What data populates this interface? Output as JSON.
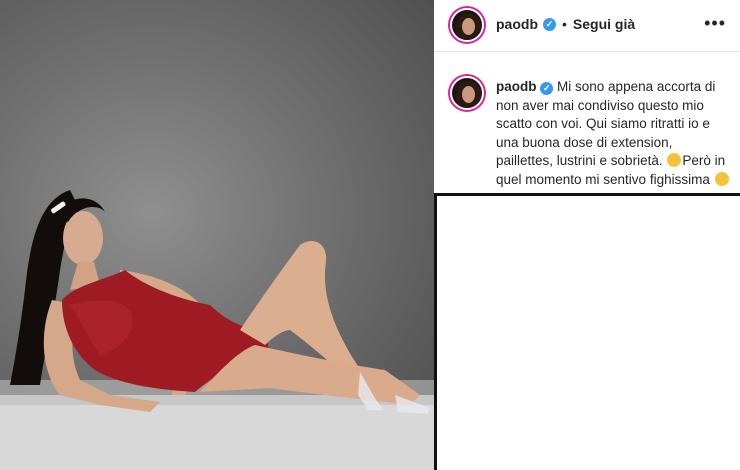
{
  "post": {
    "header": {
      "username": "paodb",
      "separator": "•",
      "follow_label": "Segui già",
      "more_label": "•••"
    },
    "caption": {
      "username": "paodb",
      "text_1": "Mi sono appena accorta di non aver mai condiviso questo mio scatto con voi. Qui siamo ritratti io e una buona dose di extension, paillettes, lustrini e sobrietà.",
      "text_2": "Però in quel momento mi sentivo fighissima",
      "heart": "❤"
    },
    "icons": {
      "verified": "verified-badge-icon",
      "more": "more-options-icon"
    },
    "colors": {
      "swimsuit": "#9e1b24",
      "verified": "#3897f0",
      "story_ring": "#d6249f"
    }
  }
}
